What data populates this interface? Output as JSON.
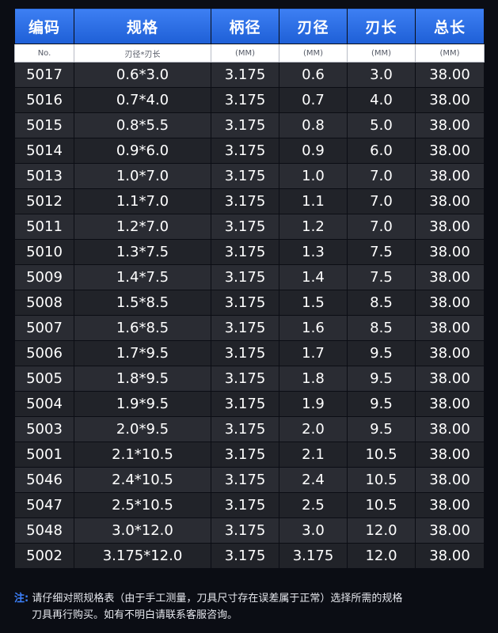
{
  "headers": [
    "编码",
    "规格",
    "柄径",
    "刃径",
    "刃长",
    "总长"
  ],
  "units": [
    "No.",
    "刃径*刃长",
    "(MM)",
    "(MM)",
    "(MM)",
    "(MM)"
  ],
  "rows": [
    [
      "5017",
      "0.6*3.0",
      "3.175",
      "0.6",
      "3.0",
      "38.00"
    ],
    [
      "5016",
      "0.7*4.0",
      "3.175",
      "0.7",
      "4.0",
      "38.00"
    ],
    [
      "5015",
      "0.8*5.5",
      "3.175",
      "0.8",
      "5.0",
      "38.00"
    ],
    [
      "5014",
      "0.9*6.0",
      "3.175",
      "0.9",
      "6.0",
      "38.00"
    ],
    [
      "5013",
      "1.0*7.0",
      "3.175",
      "1.0",
      "7.0",
      "38.00"
    ],
    [
      "5012",
      "1.1*7.0",
      "3.175",
      "1.1",
      "7.0",
      "38.00"
    ],
    [
      "5011",
      "1.2*7.0",
      "3.175",
      "1.2",
      "7.0",
      "38.00"
    ],
    [
      "5010",
      "1.3*7.5",
      "3.175",
      "1.3",
      "7.5",
      "38.00"
    ],
    [
      "5009",
      "1.4*7.5",
      "3.175",
      "1.4",
      "7.5",
      "38.00"
    ],
    [
      "5008",
      "1.5*8.5",
      "3.175",
      "1.5",
      "8.5",
      "38.00"
    ],
    [
      "5007",
      "1.6*8.5",
      "3.175",
      "1.6",
      "8.5",
      "38.00"
    ],
    [
      "5006",
      "1.7*9.5",
      "3.175",
      "1.7",
      "9.5",
      "38.00"
    ],
    [
      "5005",
      "1.8*9.5",
      "3.175",
      "1.8",
      "9.5",
      "38.00"
    ],
    [
      "5004",
      "1.9*9.5",
      "3.175",
      "1.9",
      "9.5",
      "38.00"
    ],
    [
      "5003",
      "2.0*9.5",
      "3.175",
      "2.0",
      "9.5",
      "38.00"
    ],
    [
      "5001",
      "2.1*10.5",
      "3.175",
      "2.1",
      "10.5",
      "38.00"
    ],
    [
      "5046",
      "2.4*10.5",
      "3.175",
      "2.4",
      "10.5",
      "38.00"
    ],
    [
      "5047",
      "2.5*10.5",
      "3.175",
      "2.5",
      "10.5",
      "38.00"
    ],
    [
      "5048",
      "3.0*12.0",
      "3.175",
      "3.0",
      "12.0",
      "38.00"
    ],
    [
      "5002",
      "3.175*12.0",
      "3.175",
      "3.175",
      "12.0",
      "38.00"
    ]
  ],
  "note": {
    "label": "注:",
    "line1": "请仔细对照规格表（由于手工测量，刀具尺寸存在误差属于正常）选择所需的规格",
    "line2": "刀具再行购买。如有不明白请联系客服咨询。"
  },
  "colors": {
    "header_blue": "#2a6ee6",
    "note_label": "#3d82ff",
    "background": "#0b0d14"
  }
}
